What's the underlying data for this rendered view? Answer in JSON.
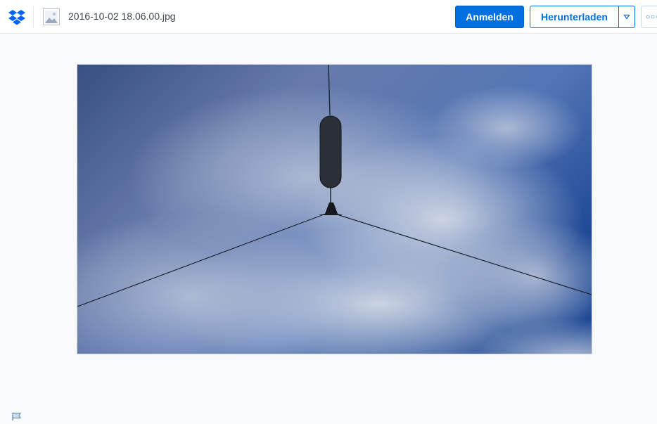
{
  "header": {
    "logo_icon": "dropbox-logo-icon",
    "file_type_icon": "image-file-icon",
    "file_name": "2016-10-02 18.06.00.jpg",
    "sign_in_label": "Anmelden",
    "download_label": "Herunterladen",
    "download_menu_icon": "triangle-down-icon",
    "more_icon": "more-options-icon"
  },
  "preview": {
    "subject_icon": "photo-preview"
  },
  "footer": {
    "feedback_icon": "flag-icon"
  },
  "colors": {
    "accent": "#0070e0",
    "background": "#f7f9fa"
  }
}
